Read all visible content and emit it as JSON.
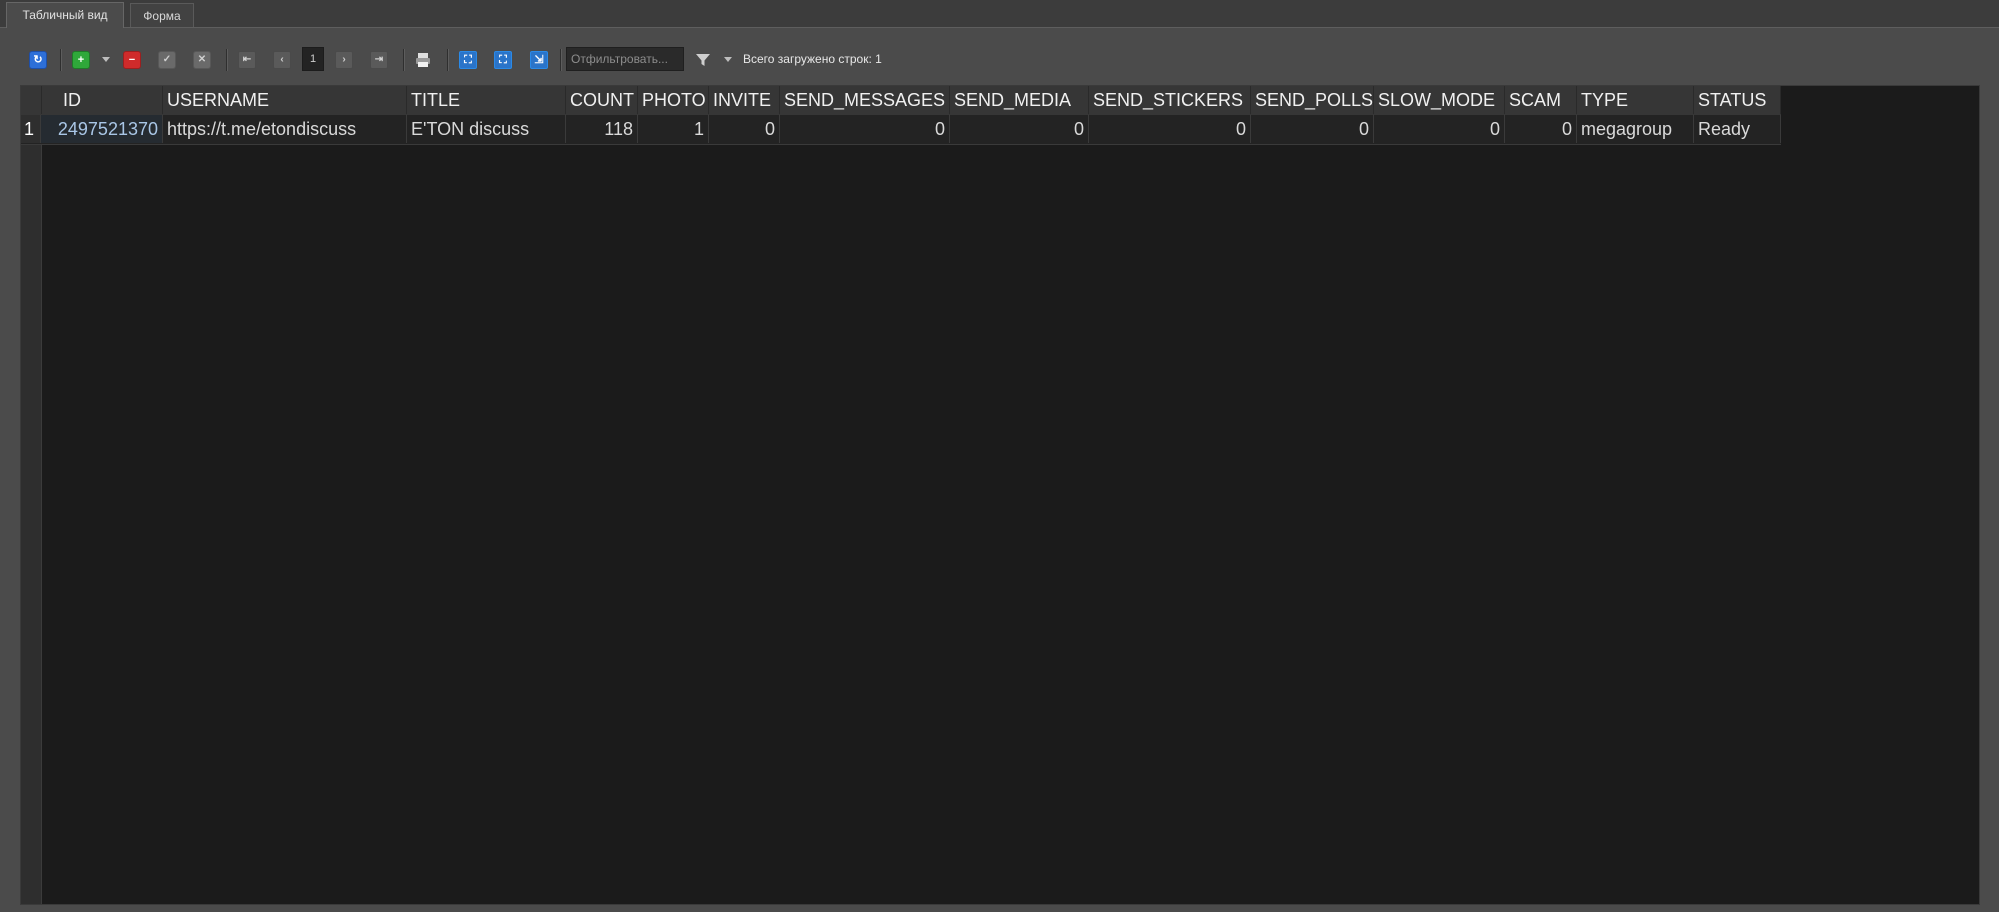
{
  "tabs": {
    "table_view": "Табличный вид",
    "form": "Форма"
  },
  "toolbar": {
    "page_number": "1",
    "filter_placeholder": "Отфильтровать...",
    "rows_loaded": "Всего загружено строк: 1"
  },
  "icons": {
    "refresh": "refresh-icon",
    "add": "plus-icon",
    "delete": "minus-icon",
    "apply": "check-icon",
    "cancel": "close-icon",
    "first_page": "first-page-icon",
    "prev_page": "prev-page-icon",
    "next_page": "next-page-icon",
    "last_page": "last-page-icon",
    "print": "printer-icon",
    "filter": "funnel-icon"
  },
  "colors": {
    "accent_blue": "#2d6fd8",
    "add_green": "#2fa83a",
    "delete_red": "#cf2b2b",
    "grid_background": "#1b1b1b"
  },
  "table": {
    "columns": [
      "ID",
      "USERNAME",
      "TITLE",
      "COUNT",
      "PHOTO",
      "INVITE",
      "SEND_MESSAGES",
      "SEND_MEDIA",
      "SEND_STICKERS",
      "SEND_POLLS",
      "SLOW_MODE",
      "SCAM",
      "TYPE",
      "STATUS"
    ],
    "rows": [
      {
        "row_number": "1",
        "cells": [
          "2497521370",
          "https://t.me/etondiscuss",
          "E'TON discuss",
          "118",
          "1",
          "0",
          "0",
          "0",
          "0",
          "0",
          "0",
          "0",
          "megagroup",
          "Ready"
        ]
      }
    ]
  }
}
